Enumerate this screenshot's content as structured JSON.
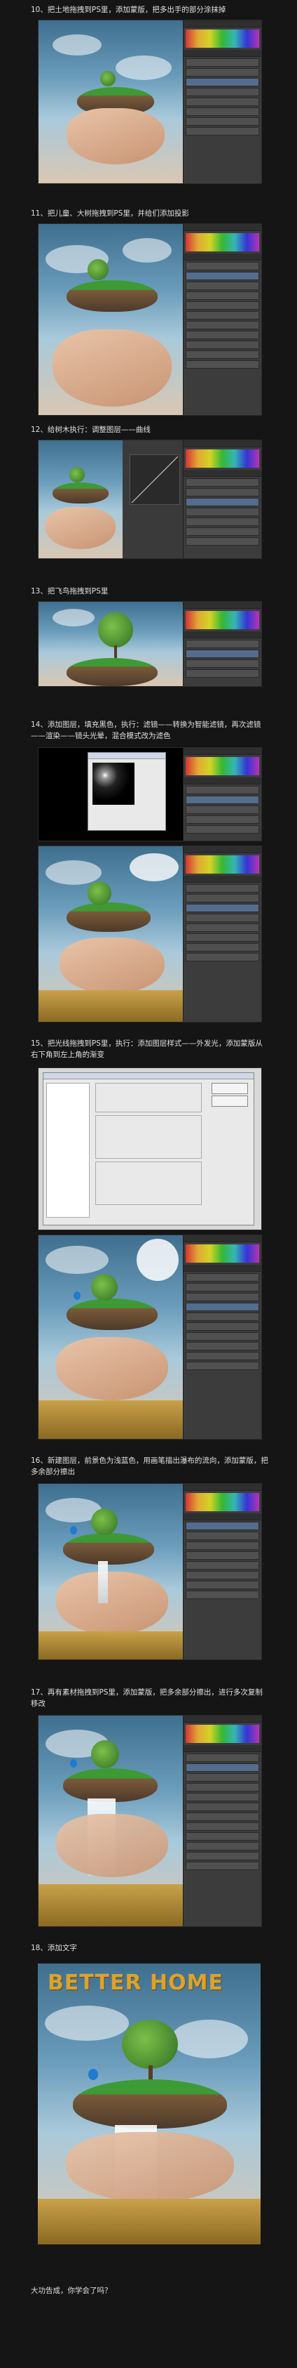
{
  "steps": [
    {
      "label": "10、把土地拖拽到PS里，添加蒙版，把多出手的部分涂抹掉"
    },
    {
      "label": "11、把儿童、大树拖拽到PS里，并给们添加投影"
    },
    {
      "label": "12、给树木执行：调整图层——曲线"
    },
    {
      "label": "13、把飞鸟拖拽到PS里"
    },
    {
      "label": "14、添加图层，填充黑色，执行：滤镜——转换为智能滤镜，再次滤镜——渲染——镜头光晕，混合模式改为滤色"
    },
    {
      "label": "15、把光线拖拽到PS里，执行：添加图层样式——外发光，添加蒙版从右下角到左上角的渐变"
    },
    {
      "label": "16、新建图层，前景色为浅蓝色，用画笔描出瀑布的流向，添加蒙版，把多余部分擦出"
    },
    {
      "label": "17、再有素材拖拽到PS里，添加蒙版，把多余部分擦出，进行多次复制移改"
    },
    {
      "label": "18、添加文字"
    }
  ],
  "final_title": "BETTER HOME",
  "closing": "大功告成，你学会了吗？",
  "colors": {
    "background": "#151515",
    "title": "#d9a330"
  }
}
